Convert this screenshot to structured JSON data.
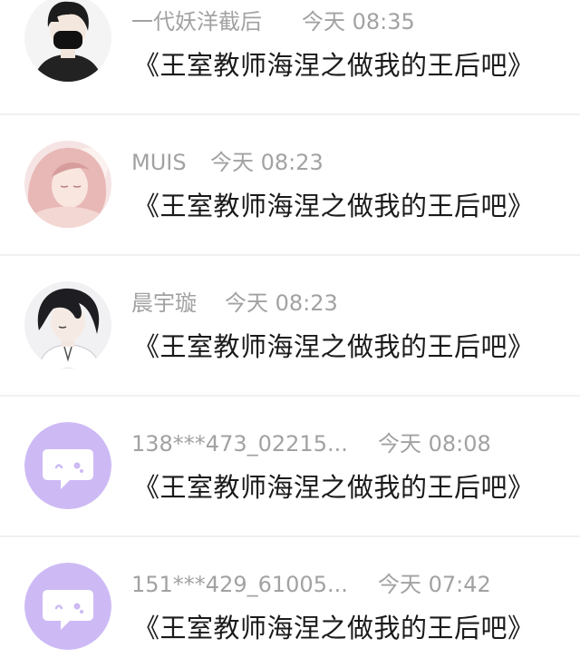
{
  "comments": [
    {
      "username": "一代妖洋截后",
      "time": "今天 08:35",
      "book_title": "《王室教师海涅之做我的王后吧》",
      "avatar_icon": "masked-boy-avatar-icon"
    },
    {
      "username": "MUIS",
      "time": "今天 08:23",
      "book_title": "《王室教师海涅之做我的王后吧》",
      "avatar_icon": "pink-hair-girl-avatar-icon"
    },
    {
      "username": "晨宇璇",
      "time": "今天 08:23",
      "book_title": "《王室教师海涅之做我的王后吧》",
      "avatar_icon": "dark-hair-boy-avatar-icon"
    },
    {
      "username": "138***473_02215...",
      "time": "今天 08:08",
      "book_title": "《王室教师海涅之做我的王后吧》",
      "avatar_icon": "default-chat-bubble-avatar-icon"
    },
    {
      "username": "151***429_61005...",
      "time": "今天 07:42",
      "book_title": "《王室教师海涅之做我的王后吧》",
      "avatar_icon": "default-chat-bubble-avatar-icon"
    }
  ],
  "colors": {
    "meta_text": "#a2a2a2",
    "title_text": "#1a1a1a",
    "default_avatar_bg": "#cdbaf5",
    "divider": "#f1f1f1"
  }
}
